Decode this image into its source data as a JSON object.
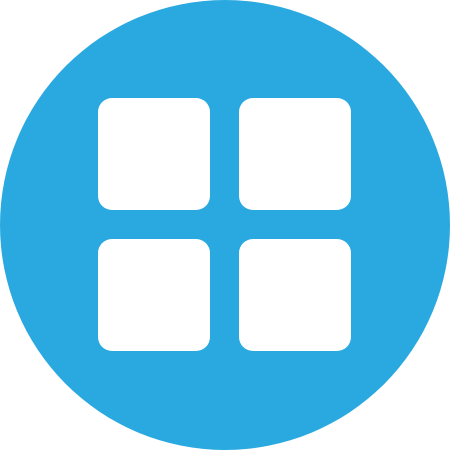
{
  "icon": {
    "name": "grid-apps-icon",
    "background_color": "#2aa9e0",
    "tile_color": "#ffffff",
    "tiles": [
      "top-left",
      "top-right",
      "bottom-left",
      "bottom-right"
    ]
  }
}
